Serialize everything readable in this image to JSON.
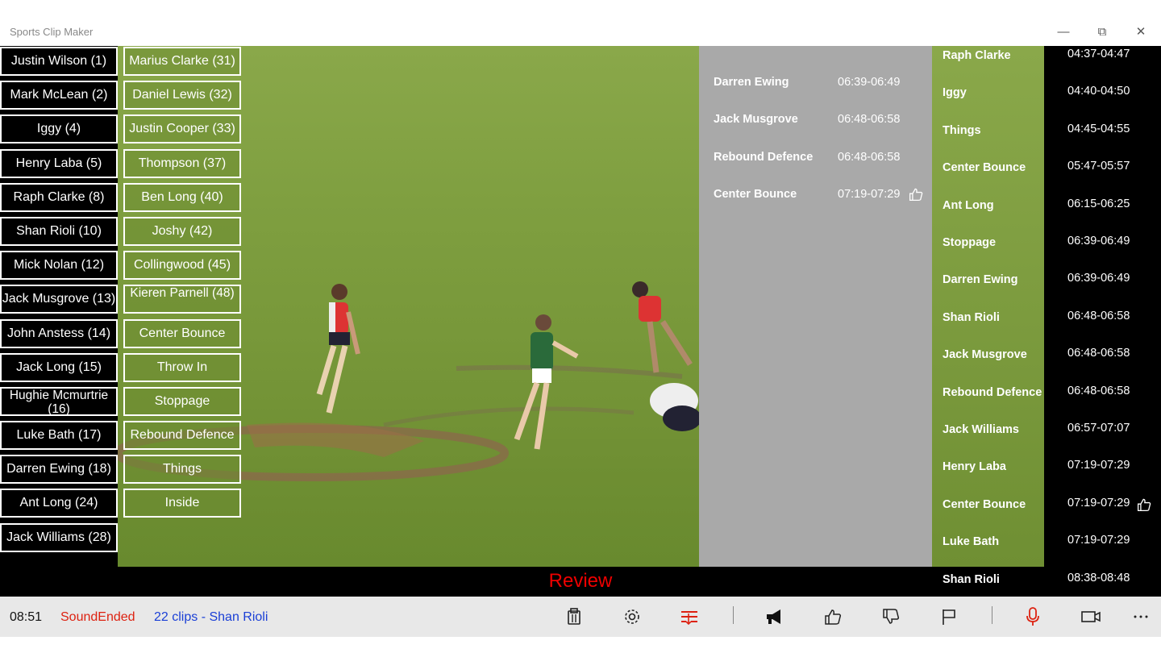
{
  "window": {
    "title": "Sports Clip Maker",
    "minimize": "—",
    "maximize": "⧉",
    "close": "✕"
  },
  "players_col1": [
    "Justin Wilson (1)",
    "Mark McLean (2)",
    "Iggy (4)",
    "Henry Laba (5)",
    "Raph Clarke (8)",
    "Shan Rioli (10)",
    "Mick Nolan (12)",
    "Jack Musgrove (13)",
    "John Anstess (14)",
    "Jack Long (15)",
    "Hughie Mcmurtrie (16)",
    "Luke Bath (17)",
    "Darren Ewing (18)",
    "Ant Long (24)",
    "Jack Williams (28)"
  ],
  "players_col2": [
    "Marius Clarke (31)",
    "Daniel Lewis (32)",
    "Justin Cooper (33)",
    "Thompson (37)",
    "Ben Long (40)",
    "Joshy (42)",
    "Collingwood (45)",
    "Kieren Parnell (48)",
    "Center Bounce",
    "Throw In",
    "Stoppage",
    "Rebound Defence",
    "Things",
    "Inside"
  ],
  "queue": [
    {
      "name": "Darren Ewing",
      "time": "06:39-06:49",
      "liked": false
    },
    {
      "name": "Jack Musgrove",
      "time": "06:48-06:58",
      "liked": false
    },
    {
      "name": "Rebound Defence",
      "time": "06:48-06:58",
      "liked": false
    },
    {
      "name": "Center Bounce",
      "time": "07:19-07:29",
      "liked": true
    }
  ],
  "clips": [
    {
      "name": "Raph Clarke",
      "time": "04:37-04:47",
      "liked": false
    },
    {
      "name": "Iggy",
      "time": "04:40-04:50",
      "liked": false
    },
    {
      "name": "Things",
      "time": "04:45-04:55",
      "liked": false
    },
    {
      "name": "Center Bounce",
      "time": "05:47-05:57",
      "liked": false
    },
    {
      "name": "Ant Long",
      "time": "06:15-06:25",
      "liked": false
    },
    {
      "name": "Stoppage",
      "time": "06:39-06:49",
      "liked": false
    },
    {
      "name": "Darren Ewing",
      "time": "06:39-06:49",
      "liked": false
    },
    {
      "name": "Shan Rioli",
      "time": "06:48-06:58",
      "liked": false
    },
    {
      "name": "Jack Musgrove",
      "time": "06:48-06:58",
      "liked": false
    },
    {
      "name": "Rebound Defence",
      "time": "06:48-06:58",
      "liked": false
    },
    {
      "name": "Jack Williams",
      "time": "06:57-07:07",
      "liked": false
    },
    {
      "name": "Henry Laba",
      "time": "07:19-07:29",
      "liked": false
    },
    {
      "name": "Center Bounce",
      "time": "07:19-07:29",
      "liked": true
    },
    {
      "name": "Luke Bath",
      "time": "07:19-07:29",
      "liked": false
    },
    {
      "name": "Shan Rioli",
      "time": "08:38-08:48",
      "liked": false
    }
  ],
  "review_label": "Review",
  "statusbar": {
    "clock": "08:51",
    "status": "SoundEnded",
    "clip_summary": "22 clips - Shan Rioli"
  },
  "toolbar_icons": [
    "clipboard-icon",
    "gear-icon",
    "split-icon",
    "megaphone-icon",
    "thumbs-up-icon",
    "thumbs-down-icon",
    "flag-icon",
    "microphone-icon",
    "video-camera-icon",
    "more-icon"
  ],
  "colors": {
    "status_red": "#d21111",
    "link_blue": "#1a3fd6",
    "review_red": "#e00000",
    "queue_grey": "#a9a9a9"
  }
}
